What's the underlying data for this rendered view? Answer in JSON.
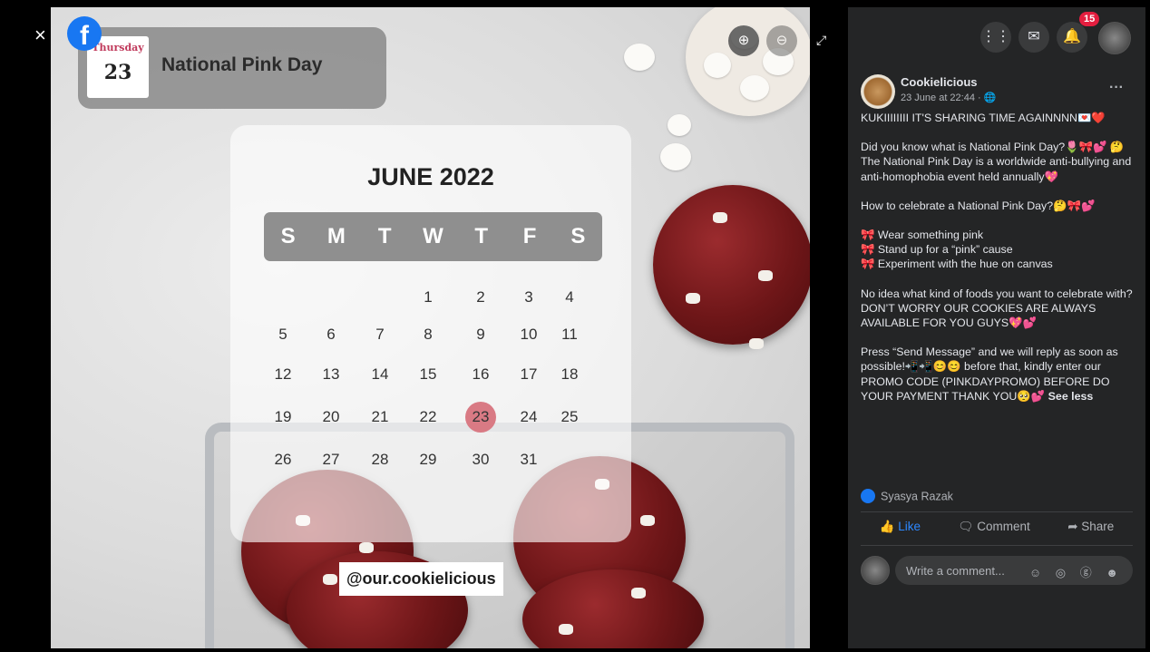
{
  "viewer": {
    "close_icon": "×",
    "fb_logo": "f",
    "zoom_in_icon": "⊕",
    "zoom_out_icon": "⊖",
    "expand_icon": "⤢"
  },
  "photo": {
    "date_card": {
      "weekday": "Thursday",
      "day": "23",
      "title": "National Pink Day"
    },
    "calendar": {
      "month": "JUNE 2022",
      "weekdays": [
        "S",
        "M",
        "T",
        "W",
        "T",
        "F",
        "S"
      ],
      "weeks": [
        [
          "",
          "",
          "",
          "1",
          "2",
          "3",
          "4"
        ],
        [
          "5",
          "6",
          "7",
          "8",
          "9",
          "10",
          "11"
        ],
        [
          "12",
          "13",
          "14",
          "15",
          "16",
          "17",
          "18"
        ],
        [
          "19",
          "20",
          "21",
          "22",
          "23",
          "24",
          "25"
        ],
        [
          "26",
          "27",
          "28",
          "29",
          "30",
          "31",
          ""
        ]
      ],
      "highlighted_day": "23"
    },
    "handle": "@our.cookielicious"
  },
  "topbar": {
    "menu_icon": "grid-icon",
    "messenger_icon": "messenger-icon",
    "bell_icon": "bell-icon",
    "notif_count": "15"
  },
  "post": {
    "page_name": "Cookielicious",
    "time": "23 June at 22:44 · 🌐",
    "more": "···",
    "paragraphs": [
      "KUKIIIIIIII IT'S SHARING TIME AGAINNNN💌❤️",
      "Did you know what is National Pink Day?🌷🎀💕 🤔The National Pink Day is a worldwide anti-bullying and anti-homophobia event held annually💖",
      "How to celebrate a National Pink Day?🤔🎀💕",
      "🎀 Wear something pink\n🎀 Stand up for a “pink” cause\n🎀 Experiment with the hue on canvas",
      "No idea what kind of foods you want to celebrate with? DON’T WORRY OUR COOKIES ARE ALWAYS AVAILABLE FOR YOU GUYS💖💕",
      "Press “Send Message” and we will reply as soon as possible!📲📲😊😊 before that, kindly enter our PROMO CODE (PINKDAYPROMO) BEFORE DO YOUR PAYMENT THANK YOU🥺💕"
    ],
    "see_less": "See less",
    "reaction_name": "Syasya Razak",
    "actions": {
      "like": "Like",
      "comment": "Comment",
      "share": "Share"
    },
    "comment_placeholder": "Write a comment...",
    "comment_icons": "☺ ◎ ⓖ ☻"
  }
}
